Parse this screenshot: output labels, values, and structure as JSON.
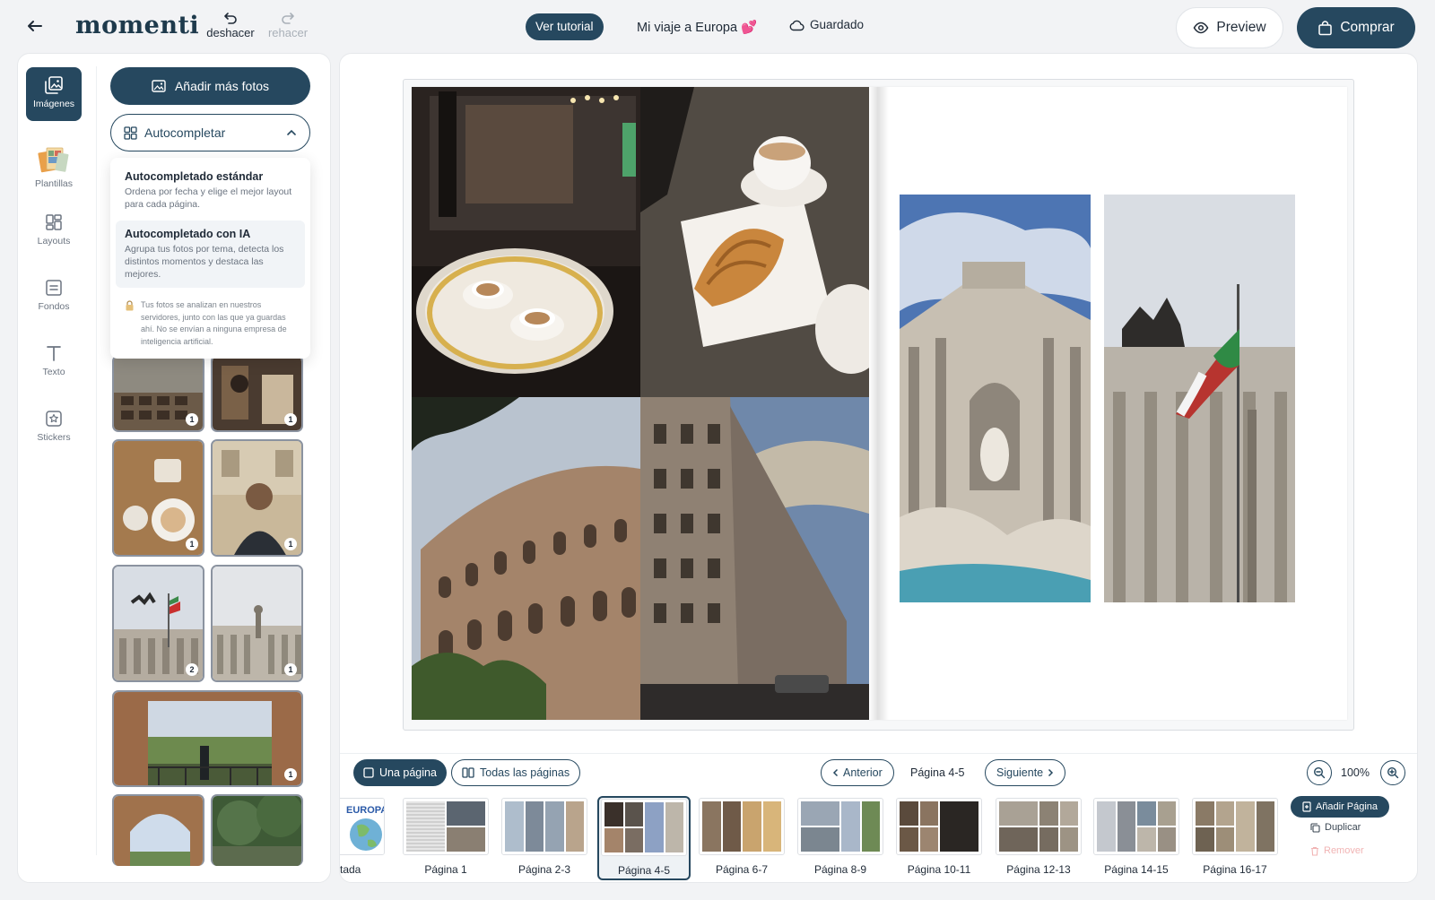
{
  "topbar": {
    "logo": "momenti",
    "undo_label": "deshacer",
    "redo_label": "rehacer",
    "tutorial_label": "Ver tutorial",
    "project_title": "Mi viaje a Europa 💕",
    "saved_label": "Guardado",
    "preview_label": "Preview",
    "buy_label": "Comprar"
  },
  "sidebar": {
    "items": [
      {
        "label": "Imágenes",
        "icon": "images-icon"
      },
      {
        "label": "Plantillas",
        "icon": "templates-icon"
      },
      {
        "label": "Layouts",
        "icon": "layouts-icon"
      },
      {
        "label": "Fondos",
        "icon": "backgrounds-icon"
      },
      {
        "label": "Texto",
        "icon": "text-icon"
      },
      {
        "label": "Stickers",
        "icon": "stickers-icon"
      }
    ]
  },
  "photos_panel": {
    "add_photos_label": "Añadir más fotos",
    "autocomplete_label": "Autocompletar",
    "autocomplete_menu": {
      "standard_title": "Autocompletado estándar",
      "standard_desc": "Ordena por fecha y elige el mejor layout para cada página.",
      "ai_title": "Autocompletado con IA",
      "ai_desc": "Agrupa tus fotos por tema, detecta los distintos momentos y destaca las mejores.",
      "privacy_note": "Tus fotos se analizan en nuestros servidores, junto con las que ya guardas ahí. No se envían a ninguna empresa de inteligencia artificial."
    },
    "thumb_badges": [
      "1",
      "1",
      "1",
      "1",
      "2",
      "1",
      "1"
    ]
  },
  "bottom_bar": {
    "one_page_label": "Una página",
    "all_pages_label": "Todas las páginas",
    "prev_label": "Anterior",
    "current_page": "Página 4-5",
    "next_label": "Siguiente",
    "zoom_level": "100%"
  },
  "page_strip": [
    {
      "label": "tada"
    },
    {
      "label": "Página 1"
    },
    {
      "label": "Página 2-3"
    },
    {
      "label": "Página 4-5",
      "selected": true
    },
    {
      "label": "Página 6-7"
    },
    {
      "label": "Página 8-9"
    },
    {
      "label": "Página 10-11"
    },
    {
      "label": "Página 12-13"
    },
    {
      "label": "Página 14-15"
    },
    {
      "label": "Página 16-17"
    }
  ],
  "strip_cover_text": "EUROPA",
  "page_actions": {
    "add_page_label": "Añadir Página",
    "duplicate_label": "Duplicar",
    "remove_label": "Remover"
  },
  "colors": {
    "primary": "#26485f",
    "background": "#f2f3f5",
    "remove": "#f1b4b4"
  }
}
